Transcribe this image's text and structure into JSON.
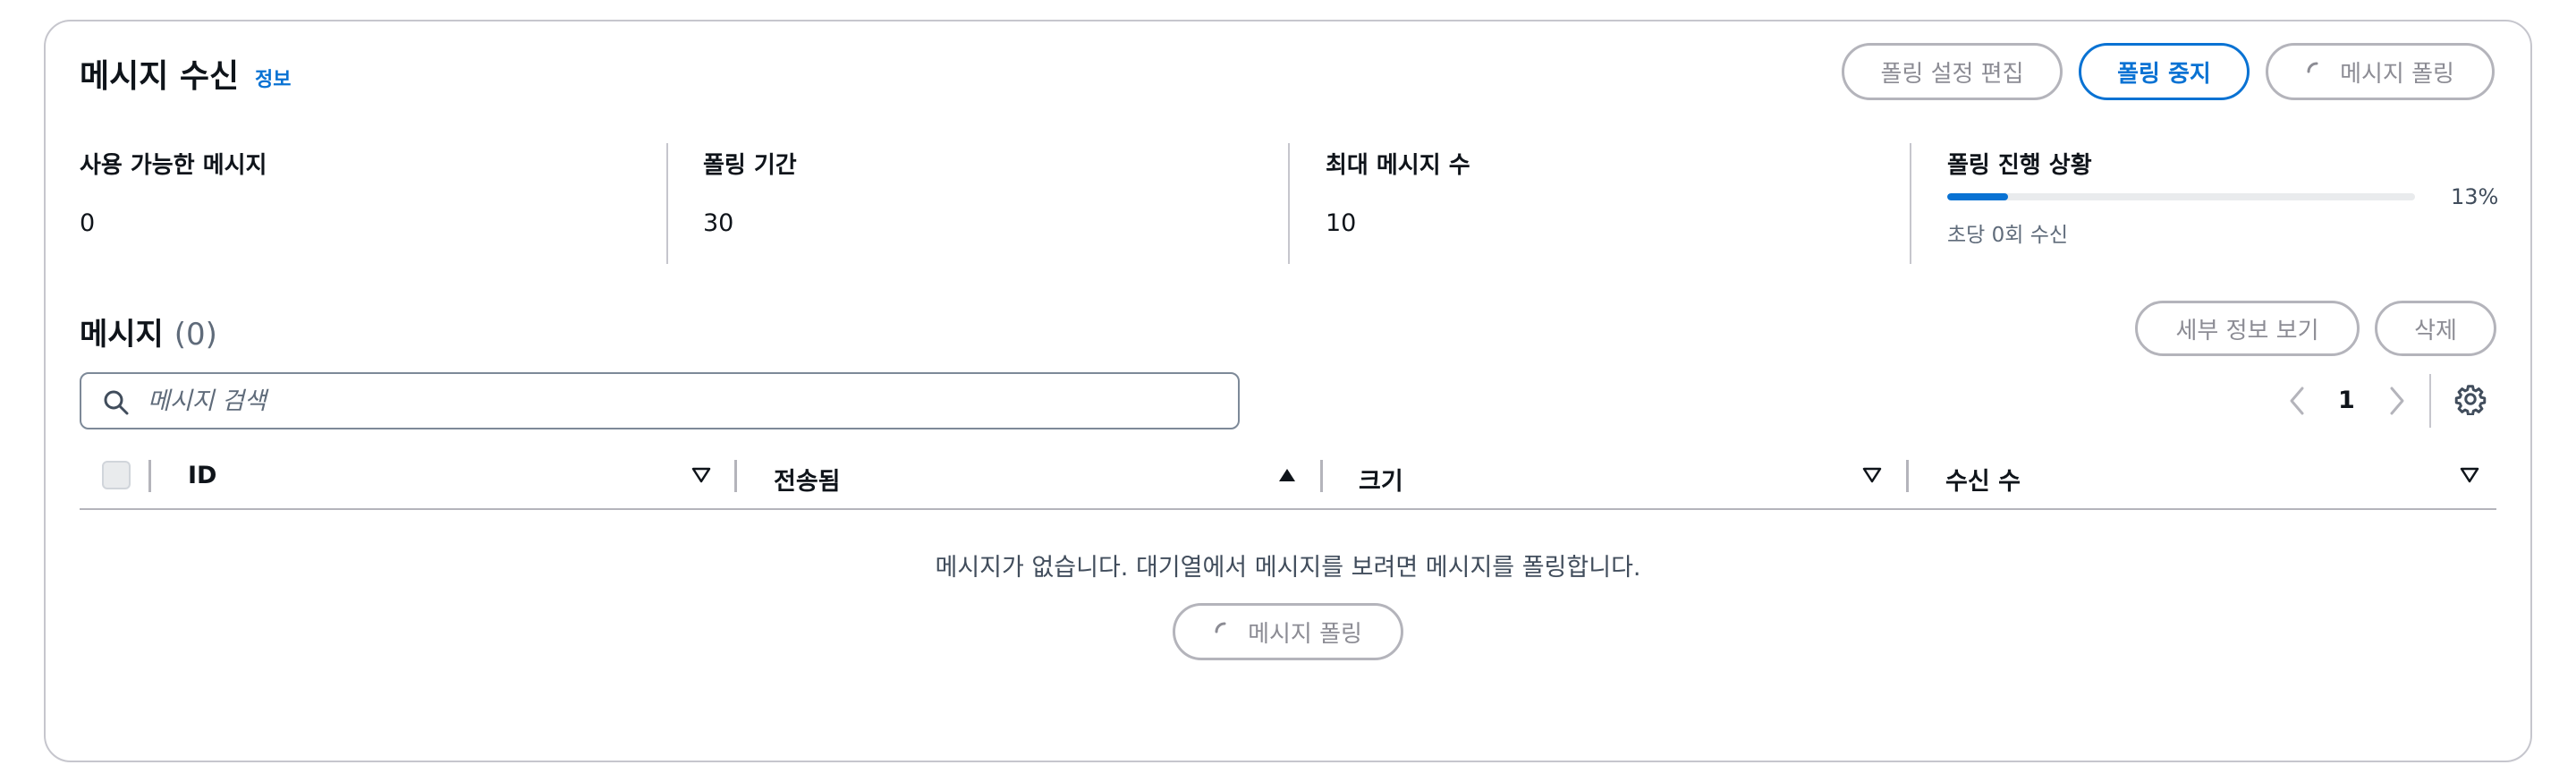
{
  "header": {
    "title": "메시지 수신",
    "info_link": "정보",
    "buttons": {
      "edit_polling": "폴링 설정 편집",
      "stop_polling": "폴링 중지",
      "poll_messages": "메시지 폴링"
    }
  },
  "stats": {
    "available": {
      "label": "사용 가능한 메시지",
      "value": "0"
    },
    "duration": {
      "label": "폴링 기간",
      "value": "30"
    },
    "max_messages": {
      "label": "최대 메시지 수",
      "value": "10"
    },
    "progress": {
      "label": "폴링 진행 상황",
      "percent_text": "13%",
      "percent": 13,
      "description": "초당 0회 수신"
    }
  },
  "messages": {
    "title": "메시지",
    "count": "(0)",
    "view_details": "세부 정보 보기",
    "delete": "삭제",
    "search_placeholder": "메시지 검색",
    "page": "1",
    "columns": {
      "id": "ID",
      "sent": "전송됨",
      "size": "크기",
      "receive_count": "수신 수"
    },
    "empty_text": "메시지가 없습니다. 대기열에서 메시지를 보려면 메시지를 폴링합니다.",
    "empty_poll_button": "메시지 폴링"
  },
  "colors": {
    "accent": "#0972d3",
    "border": "#c6c6cd",
    "muted_text": "#5f6b7a"
  }
}
